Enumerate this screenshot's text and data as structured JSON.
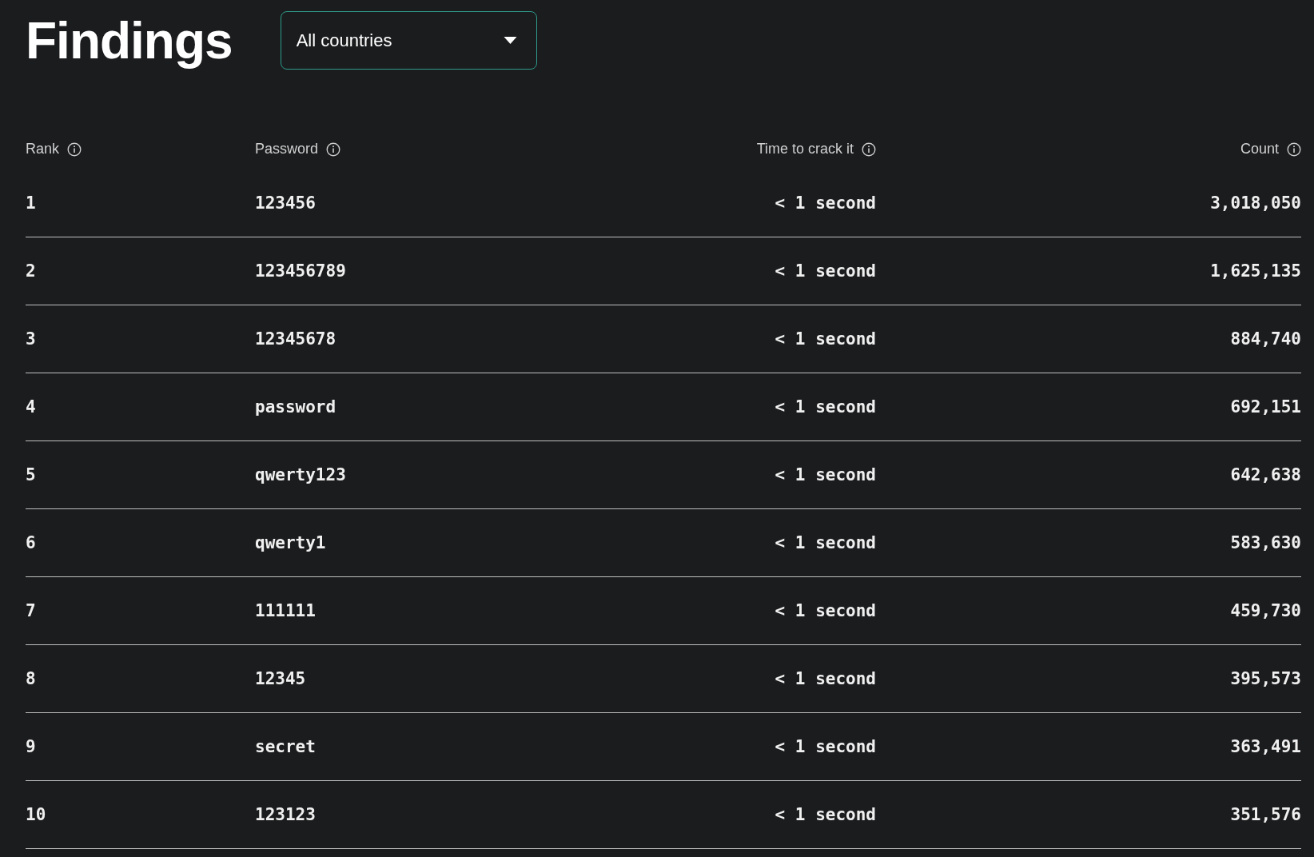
{
  "title": "Findings",
  "country_filter": {
    "value": "All countries"
  },
  "table": {
    "columns": [
      "Rank",
      "Password",
      "Time to crack it",
      "Count"
    ],
    "rows": [
      [
        "1",
        "123456",
        "< 1 second",
        "3,018,050"
      ],
      [
        "2",
        "123456789",
        "< 1 second",
        "1,625,135"
      ],
      [
        "3",
        "12345678",
        "< 1 second",
        "884,740"
      ],
      [
        "4",
        "password",
        "< 1 second",
        "692,151"
      ],
      [
        "5",
        "qwerty123",
        "< 1 second",
        "642,638"
      ],
      [
        "6",
        "qwerty1",
        "< 1 second",
        "583,630"
      ],
      [
        "7",
        "111111",
        "< 1 second",
        "459,730"
      ],
      [
        "8",
        "12345",
        "< 1 second",
        "395,573"
      ],
      [
        "9",
        "secret",
        "< 1 second",
        "363,491"
      ],
      [
        "10",
        "123123",
        "< 1 second",
        "351,576"
      ]
    ]
  }
}
